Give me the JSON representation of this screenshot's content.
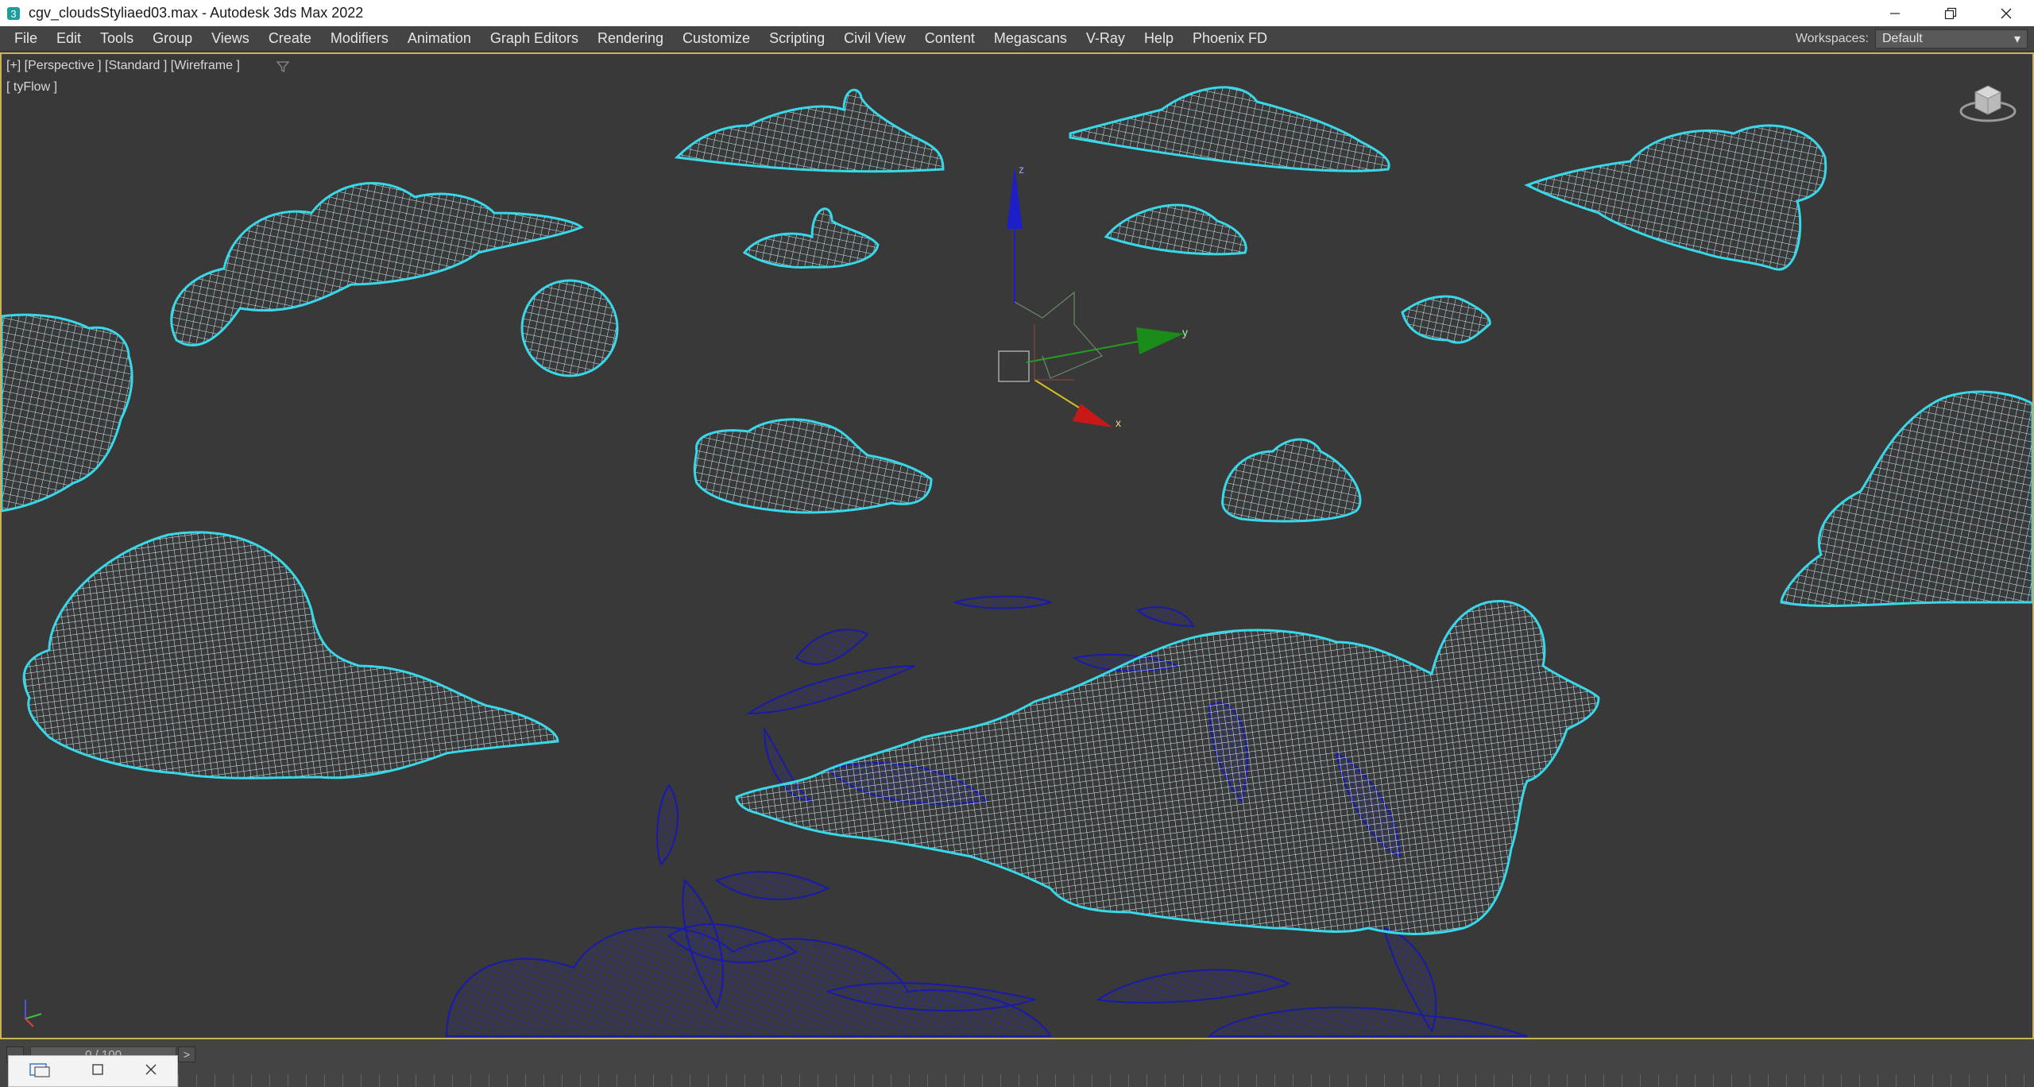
{
  "window": {
    "title": "cgv_cloudsStyliaed03.max - Autodesk 3ds Max 2022"
  },
  "menu": {
    "items": [
      "File",
      "Edit",
      "Tools",
      "Group",
      "Views",
      "Create",
      "Modifiers",
      "Animation",
      "Graph Editors",
      "Rendering",
      "Customize",
      "Scripting",
      "Civil View",
      "Content",
      "Megascans",
      "V-Ray",
      "Help",
      "Phoenix FD"
    ]
  },
  "workspaces": {
    "label": "Workspaces:",
    "value": "Default"
  },
  "viewport": {
    "labels": "[+] [Perspective ] [Standard ] [Wireframe ]",
    "sublabel": "[ tyFlow ]",
    "gizmo_axes": {
      "x": "x",
      "y": "y",
      "z": "z"
    },
    "wire_color": "#c8f0ff",
    "outline_color": "#38d8e8",
    "fx_color": "#1a1aa8",
    "border_color": "#c9b25a"
  },
  "timeline": {
    "frame_display": "0 / 100",
    "next_label": ">"
  }
}
